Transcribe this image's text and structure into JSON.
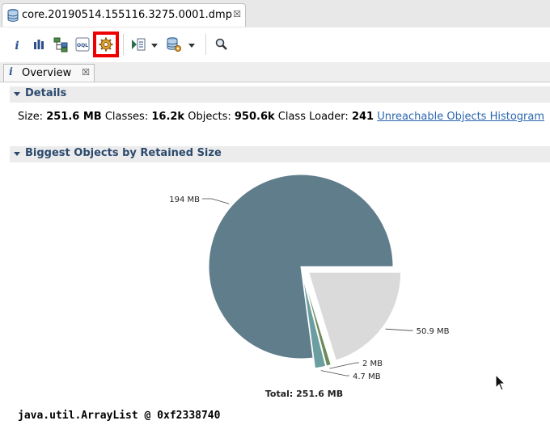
{
  "editor": {
    "tab_title": "core.20190514.155116.3275.0001.dmp",
    "tab_icon": "heap-dump-database-icon"
  },
  "toolbar": {
    "buttons": [
      {
        "name": "overview",
        "icon": "info-icon"
      },
      {
        "name": "histogram",
        "icon": "bar-chart-icon"
      },
      {
        "name": "dominator-tree",
        "icon": "dominator-tree-icon"
      },
      {
        "name": "oql",
        "icon": "oql-icon",
        "label": "OQL"
      },
      {
        "name": "heap-dump-details",
        "icon": "gear-cog-icon",
        "highlighted": true
      },
      {
        "name": "reports",
        "icon": "report-icon",
        "has_dropdown": true
      },
      {
        "name": "query-browser",
        "icon": "database-gear-icon",
        "has_dropdown": true
      },
      {
        "name": "search",
        "icon": "magnifier-icon"
      }
    ],
    "highlight_color": "#ee0000"
  },
  "view_tab": {
    "icon_text": "i",
    "label": "Overview"
  },
  "details": {
    "title": "Details",
    "size_label": "Size:",
    "size_value": "251.6 MB",
    "classes_label": "Classes:",
    "classes_value": "16.2k",
    "objects_label": "Objects:",
    "objects_value": "950.6k",
    "class_loader_label": "Class Loader:",
    "class_loader_value": "241",
    "link": "Unreachable Objects Histogram"
  },
  "biggest_objects": {
    "title": "Biggest Objects by Retained Size"
  },
  "chart_data": {
    "type": "pie",
    "total_label": "Total: 251.6 MB",
    "unit": "MB",
    "slices": [
      {
        "label": "194 MB",
        "value": 194,
        "color": "#607d8b",
        "exploded": false
      },
      {
        "label": "50.9 MB",
        "value": 50.9,
        "color": "#dadada",
        "exploded": true
      },
      {
        "label": "2 MB",
        "value": 2,
        "color": "#6c8a5a",
        "exploded": true
      },
      {
        "label": "4.7 MB",
        "value": 4.7,
        "color": "#6b9ea0",
        "exploded": true
      }
    ]
  },
  "selected_object": "java.util.ArrayList @ 0xf2338740",
  "colors": {
    "section_title": "#2c4a6e",
    "link": "#2a66b0",
    "section_background": "#ececec"
  }
}
